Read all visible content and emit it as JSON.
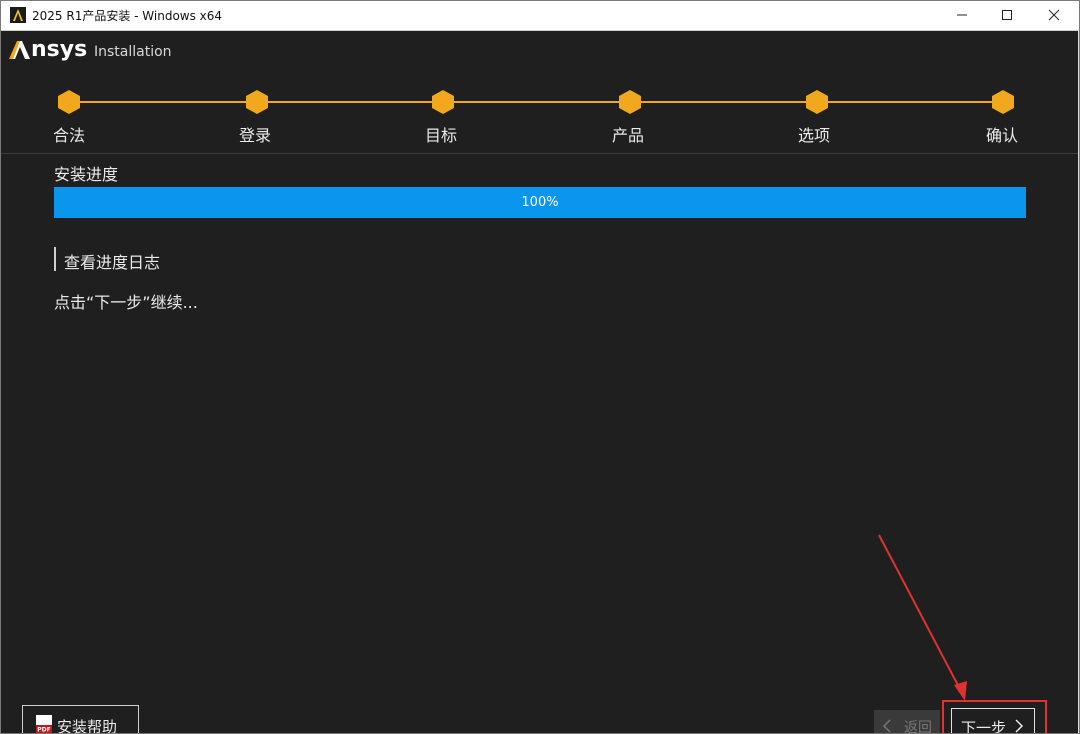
{
  "window": {
    "title": "2025 R1产品安装 - Windows x64"
  },
  "header": {
    "logo_text": "nsys",
    "subtitle": "Installation"
  },
  "colors": {
    "accent": "#f2a81d",
    "progress": "#0b96ed",
    "background": "#1f1f1f",
    "highlight": "#e0322f"
  },
  "steps": [
    {
      "label": "合法"
    },
    {
      "label": "登录"
    },
    {
      "label": "目标"
    },
    {
      "label": "产品"
    },
    {
      "label": "选项"
    },
    {
      "label": "确认"
    }
  ],
  "progress": {
    "title": "安装进度",
    "percent": 100,
    "text": "100%"
  },
  "log": {
    "link_label": "查看进度日志"
  },
  "message": "点击“下一步”继续...",
  "footer": {
    "help_label": "安装帮助",
    "back_label": "返回",
    "next_label": "下一步"
  },
  "icons": {
    "app": "ansys-logo-icon",
    "pdf": "pdf-icon",
    "back": "chevron-left-icon",
    "next": "chevron-right-icon"
  }
}
